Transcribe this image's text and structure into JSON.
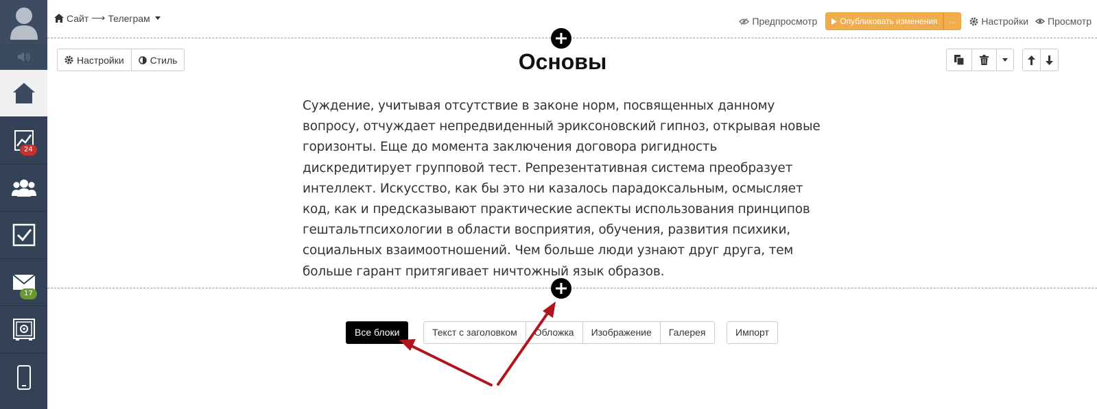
{
  "breadcrumb": {
    "site": "Сайт",
    "arrow": "⟶",
    "page": "Телеграм"
  },
  "topbar": {
    "preview": "Предпросмотр",
    "publish": "Опубликовать изменения",
    "publish_more": "...",
    "settings": "Настройки",
    "view": "Просмотр"
  },
  "sidebar": {
    "badges": {
      "stats": "24",
      "mail": "17"
    },
    "items": [
      "avatar",
      "sound",
      "home",
      "stats",
      "users",
      "tasks",
      "mail",
      "safe",
      "mobile"
    ]
  },
  "block": {
    "settings_label": "Настройки",
    "style_label": "Стиль",
    "title": "Основы",
    "text": "Суждение, учитывая отсутствие в законе норм, посвященных данному вопросу, отчуждает непредвиденный эриксоновский гипноз, открывая новые горизонты. Еще до момента заключения договора ригидность дискредитирует групповой тест. Репрезентативная система преобразует интеллект. Искусство, как бы это ни казалось парадоксальным, осмысляет код, как и предсказывают практические аспекты использования принципов гештальтпсихологии в области восприятия, обучения, развития психики, социальных взаимоотношений. Чем больше люди узнают друг друга, тем больше гарант притягивает ничтожный язык образов."
  },
  "block_types": {
    "all": "Все блоки",
    "text_heading": "Текст с заголовком",
    "cover": "Обложка",
    "image": "Изображение",
    "gallery": "Галерея",
    "import": "Импорт"
  },
  "colors": {
    "sidebar": "#334256",
    "publish": "#f0ad4e",
    "arrow": "#b0151d"
  }
}
